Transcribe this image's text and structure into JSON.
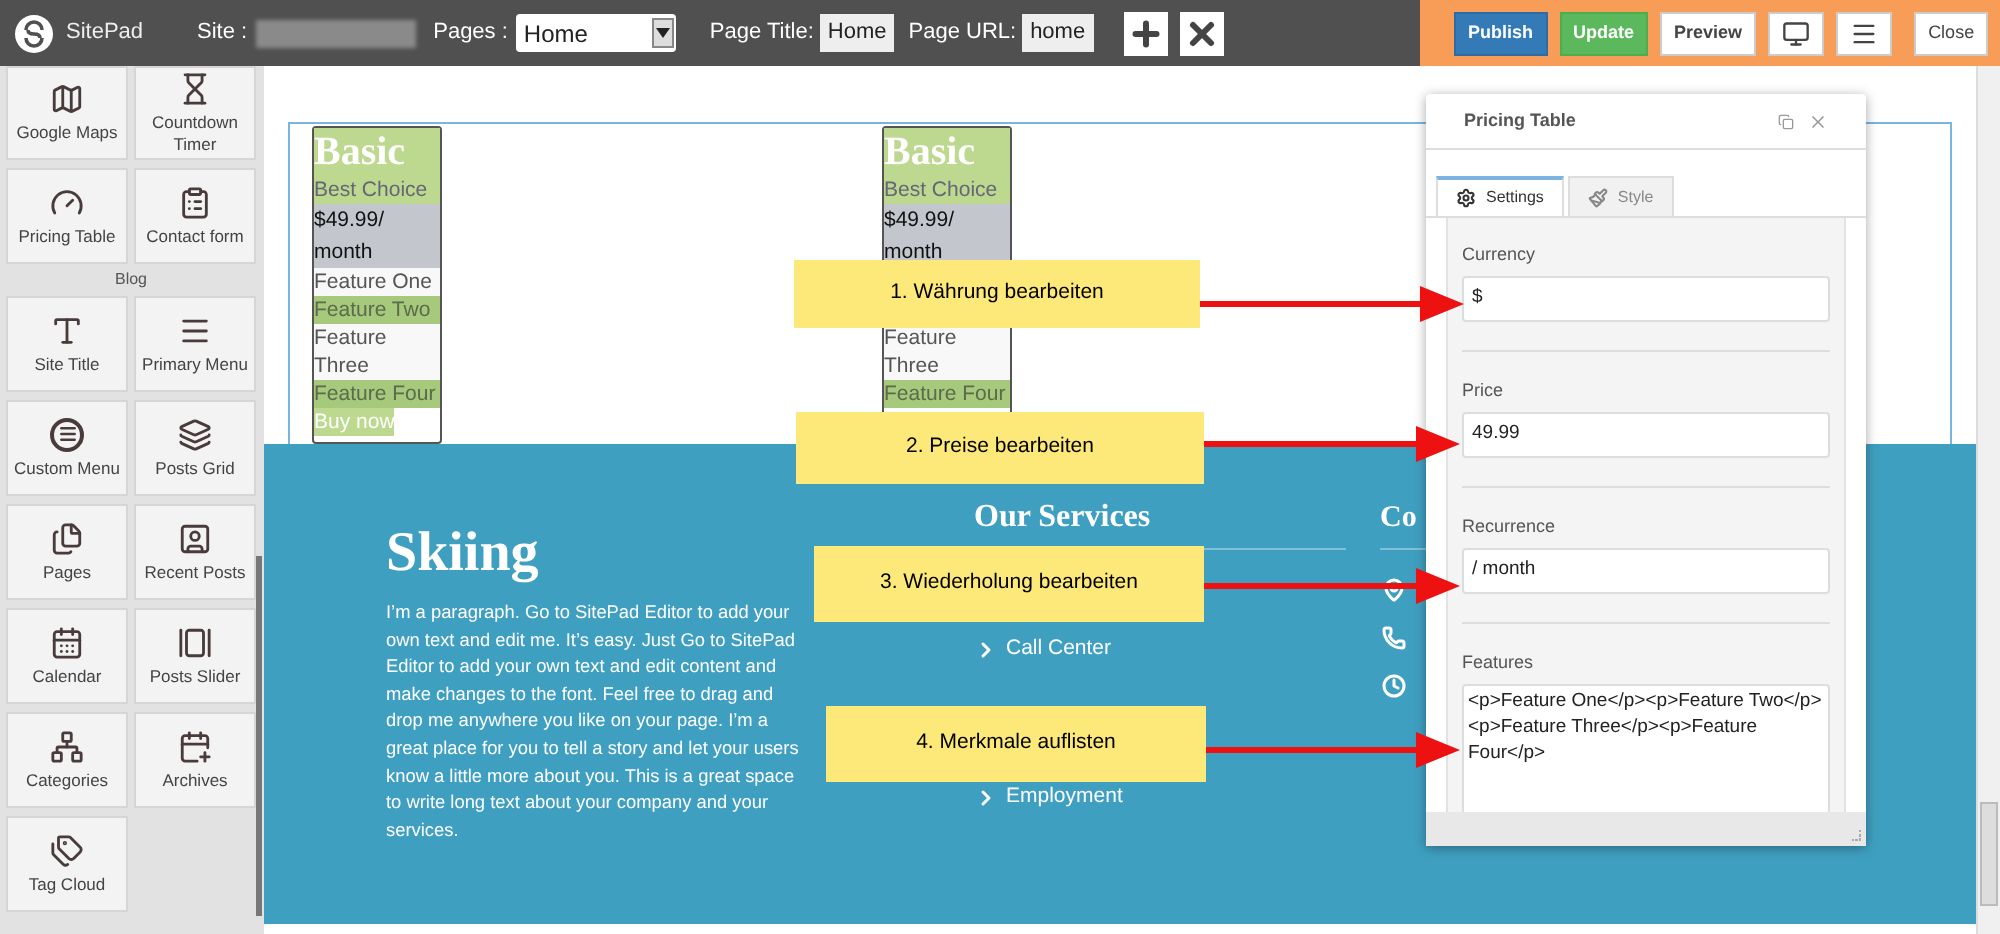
{
  "topbar": {
    "brand": "SitePad",
    "site_label": "Site :",
    "pages_label": "Pages :",
    "pages_value": "Home",
    "page_title_label": "Page Title:",
    "page_title_value": "Home",
    "page_url_label": "Page URL:",
    "page_url_value": "home",
    "actions": [
      {
        "label": "Publish",
        "kind": "primary"
      },
      {
        "label": "Update",
        "kind": "success"
      },
      {
        "label": "Preview",
        "kind": "default"
      }
    ],
    "close": "Close"
  },
  "sidebar": {
    "sections": [
      {
        "tiles": [
          "Google Maps",
          "Countdown Timer",
          "Pricing Table",
          "Contact form"
        ]
      },
      {
        "title": "Blog",
        "tiles": [
          "Site Title",
          "Primary Menu",
          "Custom Menu",
          "Posts Grid",
          "Pages",
          "Recent Posts",
          "Calendar",
          "Posts Slider",
          "Categories",
          "Archives",
          "Tag Cloud"
        ]
      }
    ]
  },
  "canvas": {
    "pricing_tables": [
      {
        "title": "Basic",
        "subtitle": "Best Choice",
        "price": "$49.99/ month",
        "features": [
          {
            "kind": "text",
            "text": "Feature One"
          },
          {
            "kind": "text",
            "text": "Feature Two"
          },
          {
            "kind": "text",
            "text": "Feature Three"
          },
          {
            "kind": "text",
            "text": "Feature Four"
          }
        ],
        "button": "Buy now"
      },
      {
        "title": "Basic",
        "subtitle": "Best Choice",
        "price": "$49.99/ month",
        "features": [
          {
            "kind": "blank"
          },
          {
            "kind": "blank"
          },
          {
            "kind": "text",
            "text": "Feature Three"
          },
          {
            "kind": "text",
            "text": "Feature Four"
          }
        ]
      }
    ],
    "section": {
      "heading": "Skiing",
      "paragraph": "I’m a paragraph. Go to SitePad Editor to add your own text and edit me. It’s easy. Just Go to SitePad Editor to add your own text and edit content and make changes to the font. Feel free to drag and drop me anywhere you like on your page. I’m a great place for you to tell a story and let your users know a little more about you. This is a great space to write long text about your company and your services.",
      "services_title": "Our Services",
      "services": [
        {
          "kind": "blank"
        },
        {
          "kind": "text",
          "text": "Call Center"
        },
        {
          "kind": "blank"
        },
        {
          "kind": "blank"
        },
        {
          "kind": "text",
          "text": "Employment"
        }
      ],
      "contact_title": "Co"
    }
  },
  "panel": {
    "title": "Pricing Table",
    "tabs": [
      {
        "label": "Settings",
        "selected": true
      },
      {
        "label": "Style",
        "selected": false
      }
    ],
    "fields": [
      {
        "label": "Currency",
        "value": "$",
        "kind": "input"
      },
      {
        "label": "Price",
        "value": "49.99",
        "kind": "input"
      },
      {
        "label": "Recurrence",
        "value": "/ month",
        "kind": "input"
      },
      {
        "label": "Features",
        "value": "<p>Feature One</p><p>Feature Two</p><p>Feature Three</p><p>Feature Four</p>",
        "kind": "textarea"
      }
    ]
  },
  "callouts": [
    {
      "text": "1. Währung bearbeiten"
    },
    {
      "text": "2. Preise bearbeiten"
    },
    {
      "text": "3. Wiederholung bearbeiten"
    },
    {
      "text": "4. Merkmale auflisten"
    }
  ]
}
